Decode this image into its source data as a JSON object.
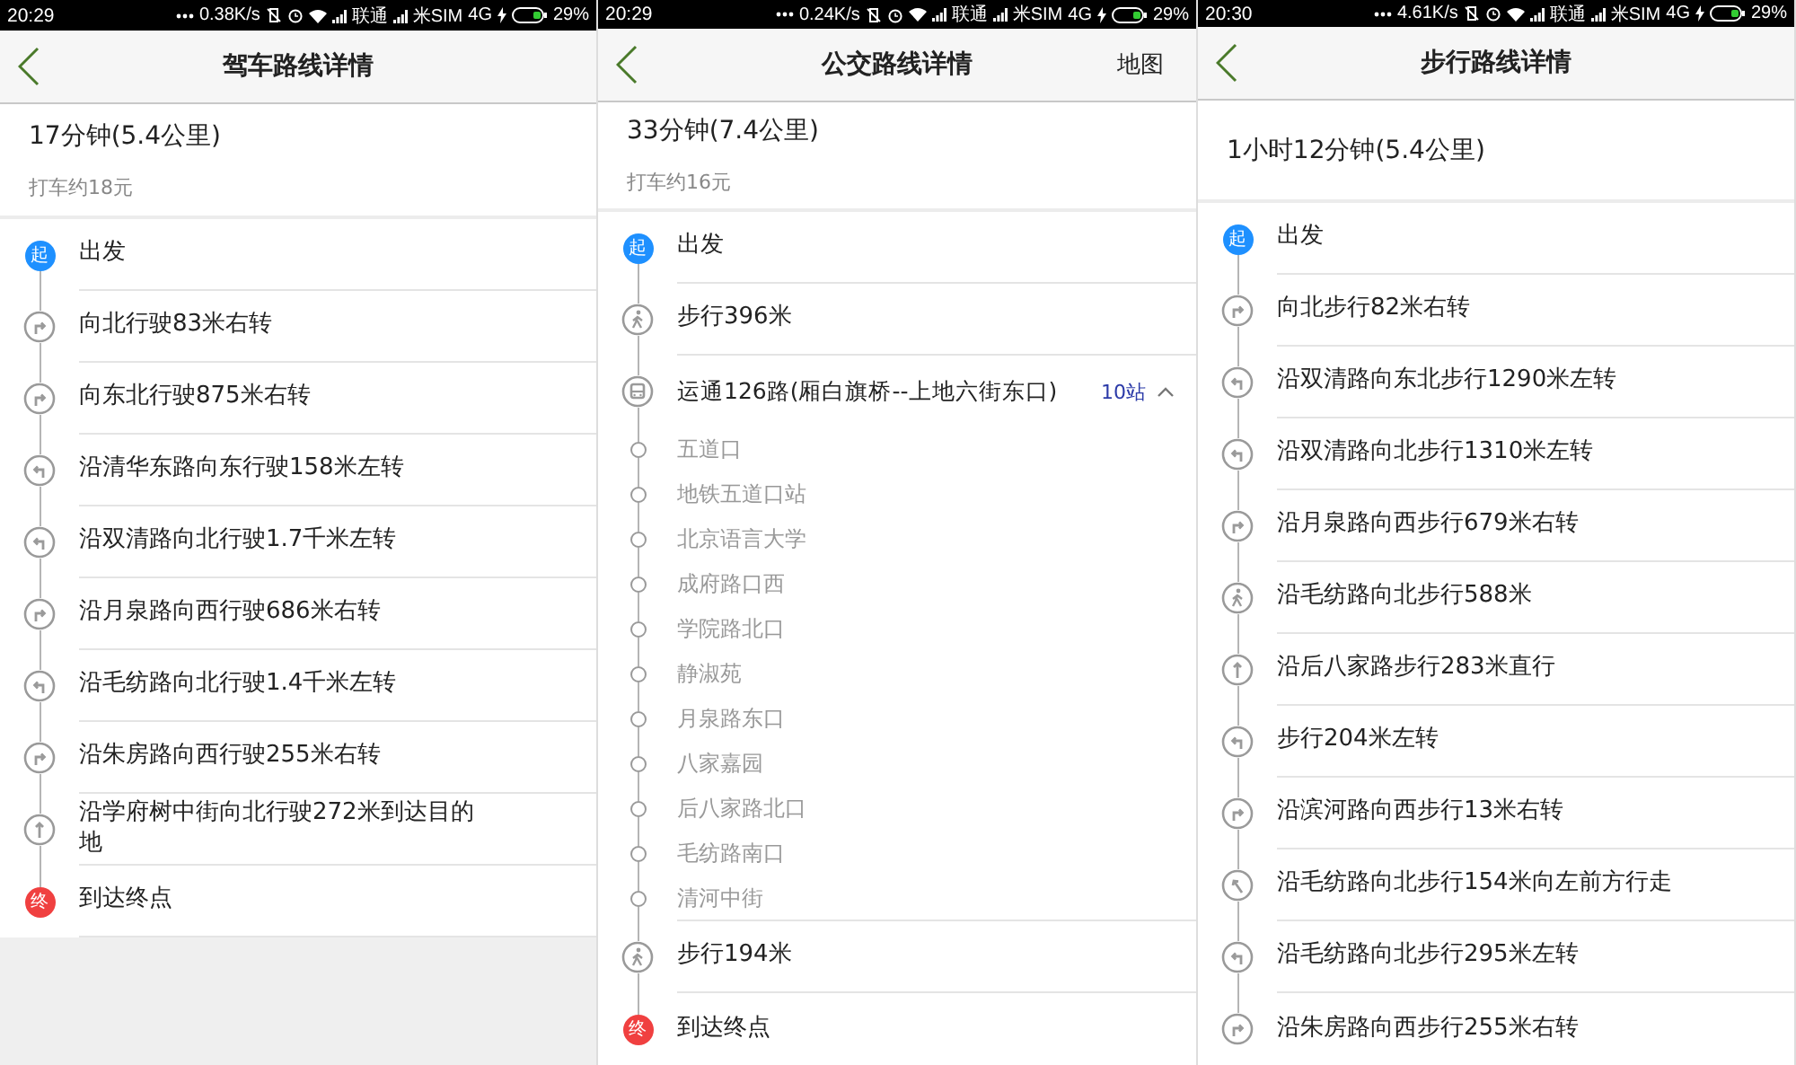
{
  "panels": [
    {
      "status_bar": {
        "time": "20:29",
        "speed": "0.38K/s",
        "carrier_1": "联通",
        "carrier_2": "米SIM",
        "network": "4G",
        "battery": "29%"
      },
      "header": {
        "title": "驾车路线详情"
      },
      "summary": {
        "duration": "17分钟(5.4公里)",
        "fare": "打车约18元"
      },
      "steps": [
        {
          "kind": "start",
          "marker": "起",
          "text": "出发"
        },
        {
          "kind": "right",
          "text": "向北行驶83米右转"
        },
        {
          "kind": "right",
          "text": "向东北行驶875米右转"
        },
        {
          "kind": "left",
          "text": "沿清华东路向东行驶158米左转"
        },
        {
          "kind": "left",
          "text": "沿双清路向北行驶1.7千米左转"
        },
        {
          "kind": "right",
          "text": "沿月泉路向西行驶686米右转"
        },
        {
          "kind": "left",
          "text": "沿毛纺路向北行驶1.4千米左转"
        },
        {
          "kind": "right",
          "text": "沿朱房路向西行驶255米右转"
        },
        {
          "kind": "straight",
          "text": "沿学府树中街向北行驶272米到达目的地"
        },
        {
          "kind": "end",
          "marker": "终",
          "text": "到达终点"
        }
      ]
    },
    {
      "status_bar": {
        "time": "20:29",
        "speed": "0.24K/s",
        "carrier_1": "联通",
        "carrier_2": "米SIM",
        "network": "4G",
        "battery": "29%"
      },
      "header": {
        "title": "公交路线详情",
        "action": "地图"
      },
      "summary": {
        "duration": "33分钟(7.4公里)",
        "fare": "打车约16元"
      },
      "steps": [
        {
          "kind": "start",
          "marker": "起",
          "text": "出发"
        },
        {
          "kind": "walk",
          "text": "步行396米"
        },
        {
          "kind": "bus",
          "text": "运通126路(厢白旗桥--上地六街东口)",
          "stop_count": "10站",
          "expanded": true
        },
        {
          "kind": "stop",
          "text": "五道口"
        },
        {
          "kind": "stop",
          "text": "地铁五道口站"
        },
        {
          "kind": "stop",
          "text": "北京语言大学"
        },
        {
          "kind": "stop",
          "text": "成府路口西"
        },
        {
          "kind": "stop",
          "text": "学院路北口"
        },
        {
          "kind": "stop",
          "text": "静淑苑"
        },
        {
          "kind": "stop",
          "text": "月泉路东口"
        },
        {
          "kind": "stop",
          "text": "八家嘉园"
        },
        {
          "kind": "stop",
          "text": "后八家路北口"
        },
        {
          "kind": "stop",
          "text": "毛纺路南口"
        },
        {
          "kind": "stop",
          "text": "清河中街"
        },
        {
          "kind": "walk",
          "text": "步行194米"
        },
        {
          "kind": "end",
          "marker": "终",
          "text": "到达终点"
        }
      ]
    },
    {
      "status_bar": {
        "time": "20:30",
        "speed": "4.61K/s",
        "carrier_1": "联通",
        "carrier_2": "米SIM",
        "network": "4G",
        "battery": "29%"
      },
      "header": {
        "title": "步行路线详情"
      },
      "summary": {
        "duration": "1小时12分钟(5.4公里)"
      },
      "steps": [
        {
          "kind": "start",
          "marker": "起",
          "text": "出发"
        },
        {
          "kind": "right",
          "text": "向北步行82米右转"
        },
        {
          "kind": "left",
          "text": "沿双清路向东北步行1290米左转"
        },
        {
          "kind": "left",
          "text": "沿双清路向北步行1310米左转"
        },
        {
          "kind": "right",
          "text": "沿月泉路向西步行679米右转"
        },
        {
          "kind": "walk",
          "text": "沿毛纺路向北步行588米"
        },
        {
          "kind": "straight",
          "text": "沿后八家路步行283米直行"
        },
        {
          "kind": "left",
          "text": "步行204米左转"
        },
        {
          "kind": "right",
          "text": "沿滨河路向西步行13米右转"
        },
        {
          "kind": "slight-left",
          "text": "沿毛纺路向北步行154米向左前方行走"
        },
        {
          "kind": "left",
          "text": "沿毛纺路向北步行295米左转"
        },
        {
          "kind": "right",
          "text": "沿朱房路向西步行255米右转"
        }
      ]
    }
  ]
}
